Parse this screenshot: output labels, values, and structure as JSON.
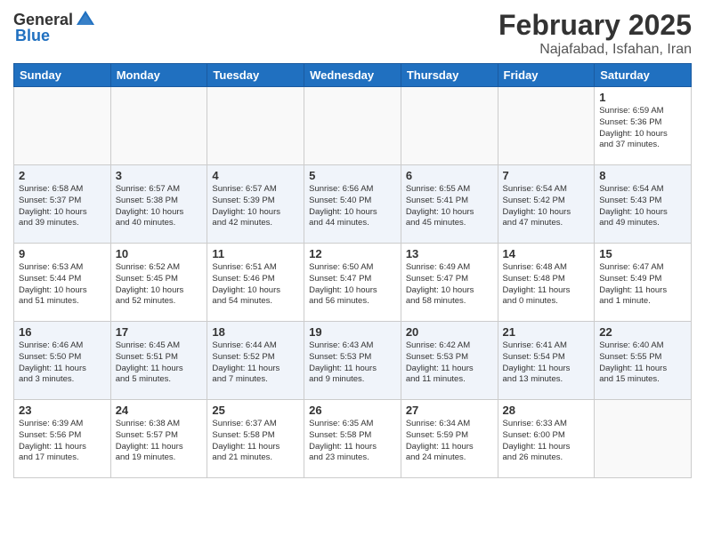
{
  "header": {
    "logo_general": "General",
    "logo_blue": "Blue",
    "month": "February 2025",
    "location": "Najafabad, Isfahan, Iran"
  },
  "weekdays": [
    "Sunday",
    "Monday",
    "Tuesday",
    "Wednesday",
    "Thursday",
    "Friday",
    "Saturday"
  ],
  "weeks": [
    [
      {
        "day": "",
        "info": ""
      },
      {
        "day": "",
        "info": ""
      },
      {
        "day": "",
        "info": ""
      },
      {
        "day": "",
        "info": ""
      },
      {
        "day": "",
        "info": ""
      },
      {
        "day": "",
        "info": ""
      },
      {
        "day": "1",
        "info": "Sunrise: 6:59 AM\nSunset: 5:36 PM\nDaylight: 10 hours\nand 37 minutes."
      }
    ],
    [
      {
        "day": "2",
        "info": "Sunrise: 6:58 AM\nSunset: 5:37 PM\nDaylight: 10 hours\nand 39 minutes."
      },
      {
        "day": "3",
        "info": "Sunrise: 6:57 AM\nSunset: 5:38 PM\nDaylight: 10 hours\nand 40 minutes."
      },
      {
        "day": "4",
        "info": "Sunrise: 6:57 AM\nSunset: 5:39 PM\nDaylight: 10 hours\nand 42 minutes."
      },
      {
        "day": "5",
        "info": "Sunrise: 6:56 AM\nSunset: 5:40 PM\nDaylight: 10 hours\nand 44 minutes."
      },
      {
        "day": "6",
        "info": "Sunrise: 6:55 AM\nSunset: 5:41 PM\nDaylight: 10 hours\nand 45 minutes."
      },
      {
        "day": "7",
        "info": "Sunrise: 6:54 AM\nSunset: 5:42 PM\nDaylight: 10 hours\nand 47 minutes."
      },
      {
        "day": "8",
        "info": "Sunrise: 6:54 AM\nSunset: 5:43 PM\nDaylight: 10 hours\nand 49 minutes."
      }
    ],
    [
      {
        "day": "9",
        "info": "Sunrise: 6:53 AM\nSunset: 5:44 PM\nDaylight: 10 hours\nand 51 minutes."
      },
      {
        "day": "10",
        "info": "Sunrise: 6:52 AM\nSunset: 5:45 PM\nDaylight: 10 hours\nand 52 minutes."
      },
      {
        "day": "11",
        "info": "Sunrise: 6:51 AM\nSunset: 5:46 PM\nDaylight: 10 hours\nand 54 minutes."
      },
      {
        "day": "12",
        "info": "Sunrise: 6:50 AM\nSunset: 5:47 PM\nDaylight: 10 hours\nand 56 minutes."
      },
      {
        "day": "13",
        "info": "Sunrise: 6:49 AM\nSunset: 5:47 PM\nDaylight: 10 hours\nand 58 minutes."
      },
      {
        "day": "14",
        "info": "Sunrise: 6:48 AM\nSunset: 5:48 PM\nDaylight: 11 hours\nand 0 minutes."
      },
      {
        "day": "15",
        "info": "Sunrise: 6:47 AM\nSunset: 5:49 PM\nDaylight: 11 hours\nand 1 minute."
      }
    ],
    [
      {
        "day": "16",
        "info": "Sunrise: 6:46 AM\nSunset: 5:50 PM\nDaylight: 11 hours\nand 3 minutes."
      },
      {
        "day": "17",
        "info": "Sunrise: 6:45 AM\nSunset: 5:51 PM\nDaylight: 11 hours\nand 5 minutes."
      },
      {
        "day": "18",
        "info": "Sunrise: 6:44 AM\nSunset: 5:52 PM\nDaylight: 11 hours\nand 7 minutes."
      },
      {
        "day": "19",
        "info": "Sunrise: 6:43 AM\nSunset: 5:53 PM\nDaylight: 11 hours\nand 9 minutes."
      },
      {
        "day": "20",
        "info": "Sunrise: 6:42 AM\nSunset: 5:53 PM\nDaylight: 11 hours\nand 11 minutes."
      },
      {
        "day": "21",
        "info": "Sunrise: 6:41 AM\nSunset: 5:54 PM\nDaylight: 11 hours\nand 13 minutes."
      },
      {
        "day": "22",
        "info": "Sunrise: 6:40 AM\nSunset: 5:55 PM\nDaylight: 11 hours\nand 15 minutes."
      }
    ],
    [
      {
        "day": "23",
        "info": "Sunrise: 6:39 AM\nSunset: 5:56 PM\nDaylight: 11 hours\nand 17 minutes."
      },
      {
        "day": "24",
        "info": "Sunrise: 6:38 AM\nSunset: 5:57 PM\nDaylight: 11 hours\nand 19 minutes."
      },
      {
        "day": "25",
        "info": "Sunrise: 6:37 AM\nSunset: 5:58 PM\nDaylight: 11 hours\nand 21 minutes."
      },
      {
        "day": "26",
        "info": "Sunrise: 6:35 AM\nSunset: 5:58 PM\nDaylight: 11 hours\nand 23 minutes."
      },
      {
        "day": "27",
        "info": "Sunrise: 6:34 AM\nSunset: 5:59 PM\nDaylight: 11 hours\nand 24 minutes."
      },
      {
        "day": "28",
        "info": "Sunrise: 6:33 AM\nSunset: 6:00 PM\nDaylight: 11 hours\nand 26 minutes."
      },
      {
        "day": "",
        "info": ""
      }
    ]
  ]
}
